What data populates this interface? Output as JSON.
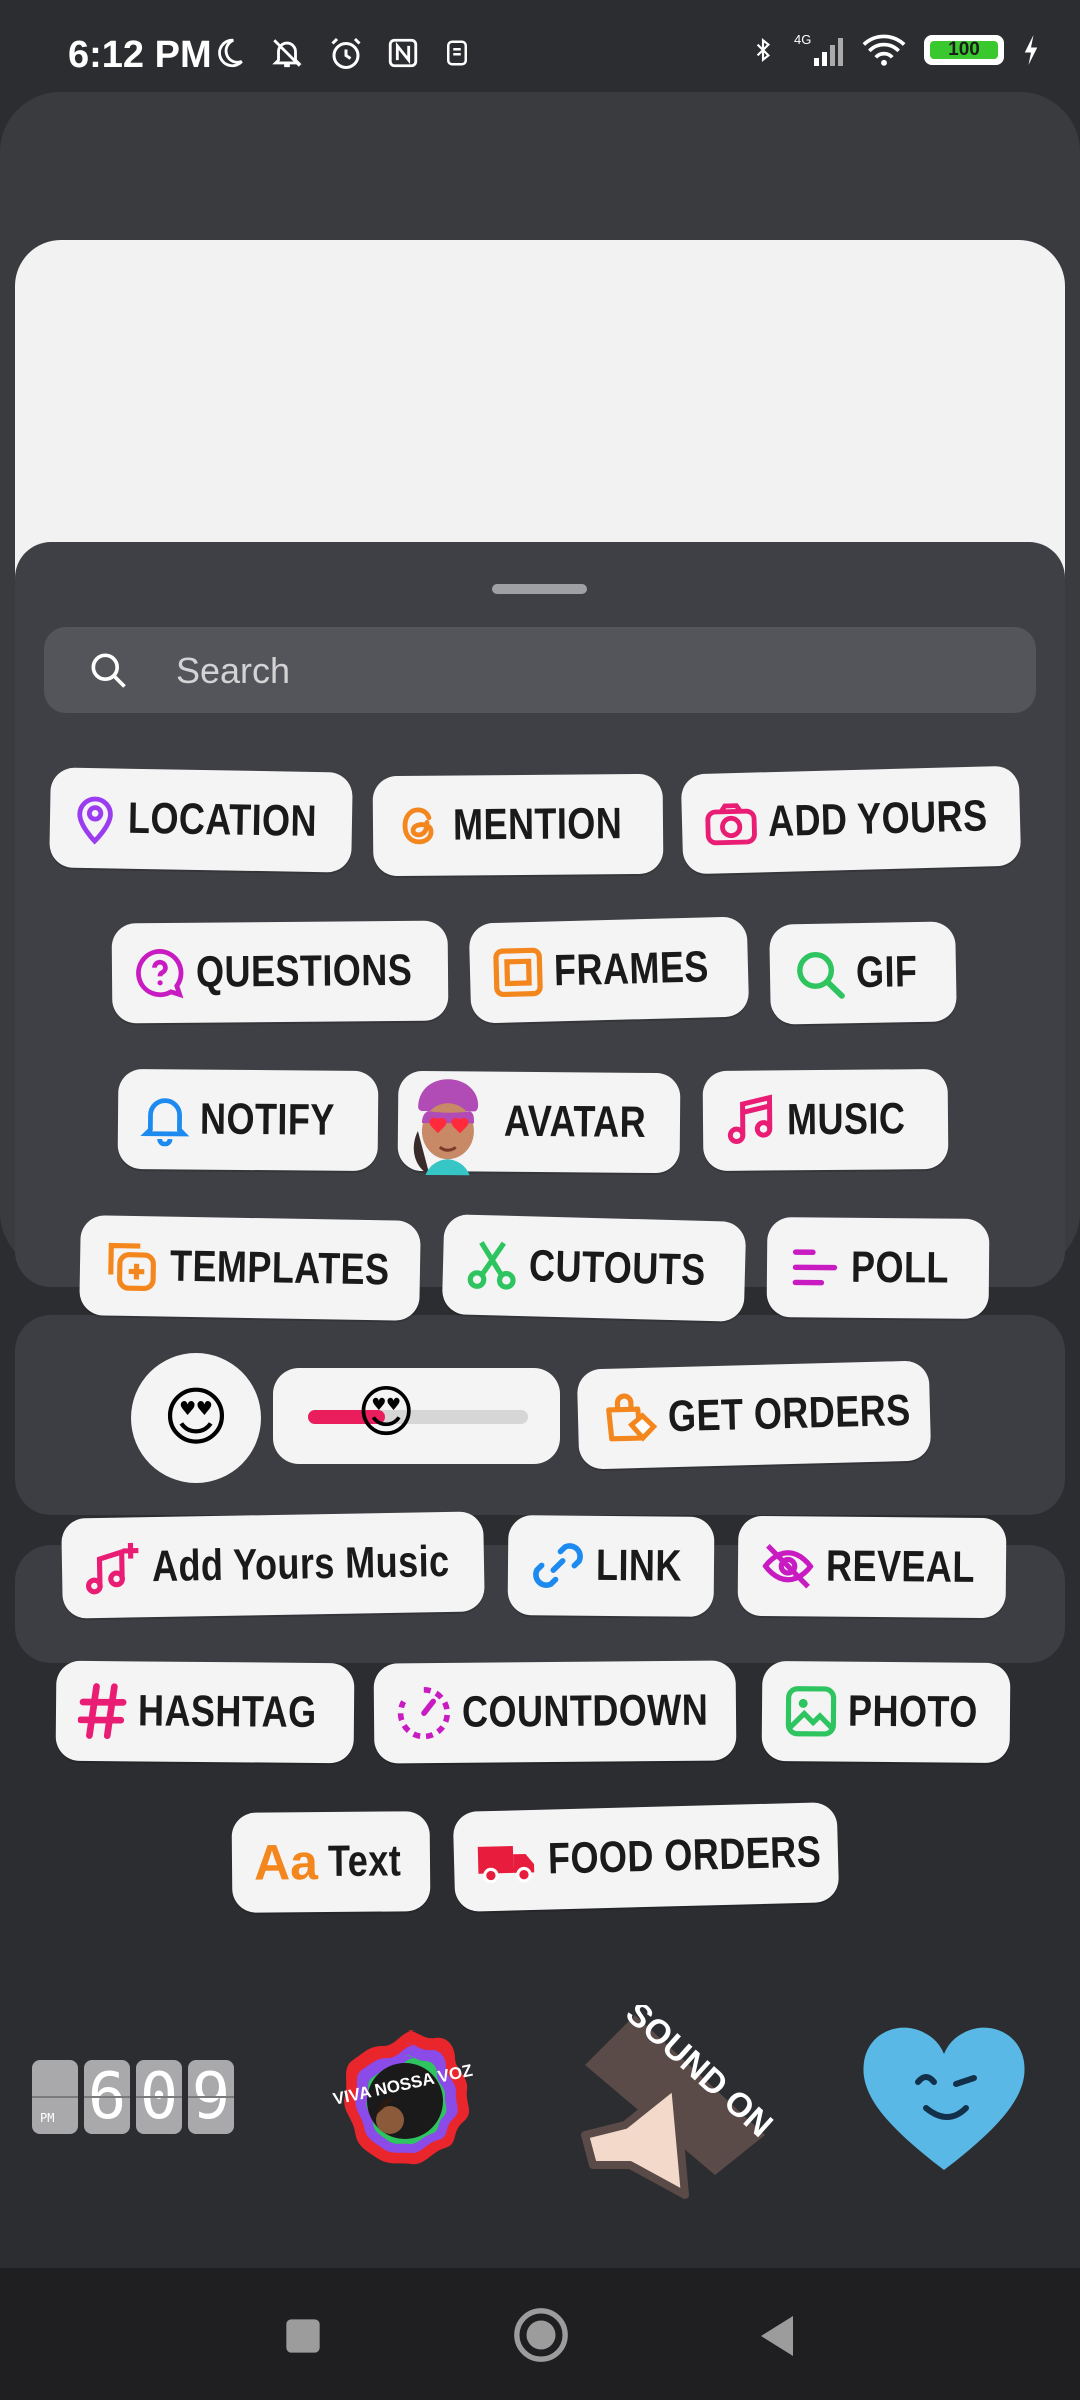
{
  "status_bar": {
    "time": "6:12 PM",
    "left_icons": [
      "moon-icon",
      "bell-off-icon",
      "alarm-icon",
      "nfc-icon",
      "sim-icon"
    ],
    "right_icons": [
      "bluetooth-icon",
      "signal-4g-icon",
      "wifi-icon",
      "battery-icon",
      "charging-icon"
    ],
    "network": "4G",
    "battery": "100"
  },
  "search": {
    "placeholder": "Search"
  },
  "stickers": {
    "location": "LOCATION",
    "mention": "MENTION",
    "add_yours": "ADD YOURS",
    "questions": "QUESTIONS",
    "frames": "FRAMES",
    "gif": "GIF",
    "notify": "NOTIFY",
    "avatar": "AVATAR",
    "music": "MUSIC",
    "templates": "TEMPLATES",
    "cutouts": "CUTOUTS",
    "poll": "POLL",
    "get_orders": "GET ORDERS",
    "add_yours_music": "Add Yours Music",
    "link": "LINK",
    "reveal": "REVEAL",
    "hashtag": "HASHTAG",
    "countdown": "COUNTDOWN",
    "photo": "PHOTO",
    "text": "Text",
    "text_glyph": "Aa",
    "food_orders": "FOOD ORDERS"
  },
  "emoji_sticker": "😍",
  "emoji_slider": {
    "knob": "😍",
    "level": 0.35
  },
  "gif_stickers": {
    "clock": {
      "ampm": "PM",
      "digits": [
        "6",
        "0",
        "9"
      ]
    },
    "viva_text": "VIVA NOSSA VOZ",
    "sound_on_text": "SOUND ON"
  },
  "colors": {
    "pink": "#ea1d74",
    "orange": "#f4861e",
    "purple": "#9b3cf0",
    "blue": "#1d8af0",
    "green": "#2ec45f",
    "magenta": "#c81cc2",
    "red": "#e81c3c"
  }
}
